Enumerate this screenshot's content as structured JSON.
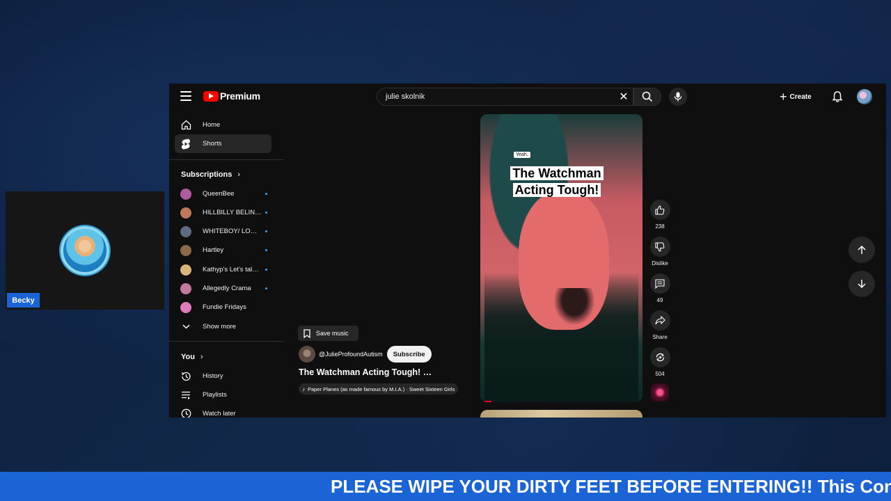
{
  "camera": {
    "name": "Becky"
  },
  "topbar": {
    "logo_text": "Premium",
    "search_value": "julie skolnik",
    "create_label": "Create"
  },
  "sidebar": {
    "nav": [
      {
        "label": "Home"
      },
      {
        "label": "Shorts"
      }
    ],
    "subscriptions_title": "Subscriptions",
    "subscriptions": [
      {
        "name": "QueenBee",
        "color": "#b05aa0"
      },
      {
        "name": "HILLBILLY BELIN…",
        "color": "#c0785a"
      },
      {
        "name": "WHITEBOY/ LO…",
        "color": "#5d6b82"
      },
      {
        "name": "Hartley",
        "color": "#8a6a4a"
      },
      {
        "name": "Kathyp's Let's tal…",
        "color": "#d8b37a"
      },
      {
        "name": "Allegedly Crama",
        "color": "#c47aa0"
      },
      {
        "name": "Fundie Fridays",
        "color": "#e07ab8"
      }
    ],
    "show_more": "Show more",
    "you_title": "You",
    "you_items": [
      {
        "label": "History"
      },
      {
        "label": "Playlists"
      },
      {
        "label": "Watch later"
      }
    ]
  },
  "short": {
    "caption_small": "Yeah.",
    "caption_title": "The Watchman Acting Tough!",
    "save_music": "Save music",
    "channel": "@JulieProfoundAutism",
    "subscribe": "Subscribe",
    "title": "The Watchman Acting Tough! …",
    "music": "Paper Planes (as made famous by M.I.A.) · Sweet Sixteen Girls"
  },
  "actions": {
    "likes": "238",
    "dislike": "Dislike",
    "comments": "49",
    "share": "Share",
    "remix": "504"
  },
  "ticker": {
    "text": "PLEASE WIPE YOUR DIRTY FEET BEFORE ENTERING!! This Conter"
  }
}
